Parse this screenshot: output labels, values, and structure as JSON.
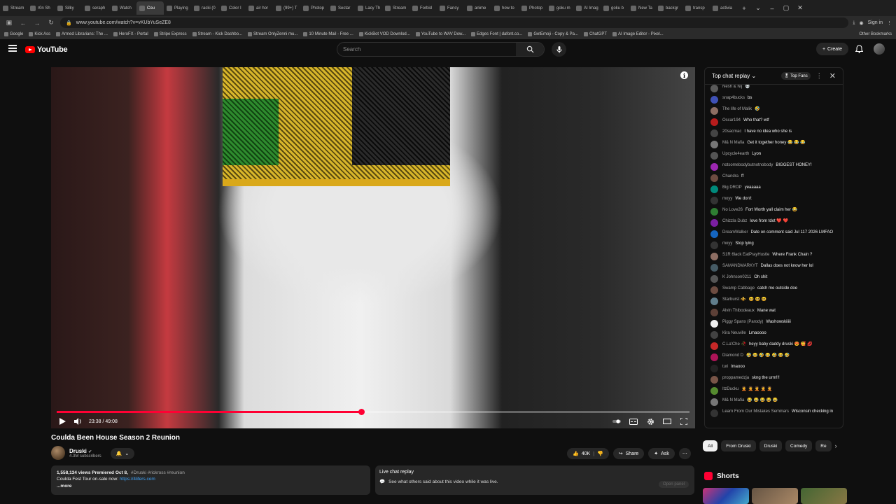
{
  "browser": {
    "tabs": [
      "Stream",
      "r0n Sh",
      "Silky",
      "seraph",
      "Watch",
      "Cou",
      "Playing",
      "racki (0",
      "Color I",
      "air hor",
      "(99+) T",
      "Photop",
      "Sectar",
      "Lacy Th",
      "Stream",
      "Forbid",
      "Fancy",
      "anime",
      "how to",
      "Photop",
      "goku m",
      "AI Imag",
      "goku b",
      "New Ta",
      "backgr",
      "transp",
      "activia"
    ],
    "active_tab_index": 5,
    "url": "www.youtube.com/watch?v=vKUbYuSeZE8",
    "sign_in": "Sign in",
    "bookmarks": [
      "Google",
      "Kick Ass",
      "Armed Librarians: The ...",
      "HeroFX - Portal",
      "Stripe Express",
      "Stream - Kick Dashbo...",
      "Stream OnlyZenni mu...",
      "10 Minute Mail - Free ...",
      "KickBot VOD Downlod...",
      "YouTube to WAV Dow...",
      "Edges Font | dafont.co...",
      "GetEmoji - Copy & Pa...",
      "ChatGPT",
      "AI Image Editor - Pixel..."
    ],
    "other_bookmarks": "Other Bookmarks"
  },
  "header": {
    "logo": "YouTube",
    "search_placeholder": "Search",
    "create_label": "Create"
  },
  "player": {
    "time": "23:38 / 49:08",
    "progress": 0.481
  },
  "chat": {
    "title": "Top chat replay",
    "top_fans": "Top Fans",
    "messages": [
      {
        "author": "Nesh & Nij",
        "text": "💀",
        "avatar_color": "#5a5a5a"
      },
      {
        "author": "snap4bucks",
        "text": "bs",
        "avatar_color": "#3f51b5"
      },
      {
        "author": "The life of Malik",
        "text": "🤣",
        "avatar_color": "#8d6e63"
      },
      {
        "author": "Oscar194",
        "text": "Who that? wtf",
        "avatar_color": "#b71c1c"
      },
      {
        "author": "20sacmac",
        "text": "I have no idea who she is",
        "avatar_color": "#444"
      },
      {
        "author": "M& N Mafia",
        "text": "Get it together honey 😂 😂 😂",
        "avatar_color": "#777"
      },
      {
        "author": "Upcycle4earth",
        "text": "Lyon",
        "avatar_color": "#555"
      },
      {
        "author": "notsomebodybutnotnobody",
        "text": "BIGGEST HONEY!",
        "avatar_color": "#9c27b0"
      },
      {
        "author": "Chandra",
        "text": "ff",
        "avatar_color": "#6d4c41"
      },
      {
        "author": "Big DROP",
        "text": "yeaaaaa",
        "avatar_color": "#00897b"
      },
      {
        "author": "moyy",
        "text": "We don't",
        "avatar_color": "#333"
      },
      {
        "author": "No Love26",
        "text": "Fort Worth yall claim her 😂",
        "avatar_color": "#2e7d32"
      },
      {
        "author": "Chizzla Dubz",
        "text": "love from tdot ❤️ ❤️",
        "avatar_color": "#7b1fa2"
      },
      {
        "author": "DreamWalker",
        "text": "Date on comment said Jul 117 2026 LMFAO",
        "avatar_color": "#1565c0"
      },
      {
        "author": "moyy",
        "text": "Stop lying",
        "avatar_color": "#333"
      },
      {
        "author": "S1R 6lack EatPrayHustle",
        "text": "Where Frank Chain ?",
        "avatar_color": "#8d6e63"
      },
      {
        "author": "SAMANDMARKYT",
        "text": "Dallas does not know her lol",
        "avatar_color": "#455a64"
      },
      {
        "author": "K Johnson0211",
        "text": "Oh shit",
        "avatar_color": "#555"
      },
      {
        "author": "Swamp Cabbage",
        "text": "catch me outside doe",
        "avatar_color": "#6d4c41"
      },
      {
        "author": "Starburst ⚜️",
        "text": "😆 😆 😆",
        "avatar_color": "#607d8b"
      },
      {
        "author": "Alvin Thibodeaux",
        "text": "Mane wat",
        "avatar_color": "#5d4037"
      },
      {
        "author": "Piggy Spanx (Parody)",
        "text": "Washowskiiiii",
        "avatar_color": "#eeeeee"
      },
      {
        "author": "Kira Neuville",
        "text": "Lmaoooo",
        "avatar_color": "#424242"
      },
      {
        "author": "C.La'Che 🥀",
        "text": "heyy baby daddy druski 😍 🥰 💋",
        "avatar_color": "#c62828"
      },
      {
        "author": "Diamond D",
        "text": "🤣 😂 🤣 😂 🤣 😂 🤣",
        "avatar_color": "#ad1457"
      },
      {
        "author": "turi",
        "text": "lmaooo",
        "avatar_color": "#222"
      },
      {
        "author": "proppamedzja",
        "text": "skng the urm!!!",
        "avatar_color": "#795548"
      },
      {
        "author": "ItzDucku",
        "text": "🤦 🤦 🤦 🤦 🤦",
        "avatar_color": "#558b2f"
      },
      {
        "author": "M& N Mafia",
        "text": "😂 😂 😂 😂 😂",
        "avatar_color": "#777"
      },
      {
        "author": "Learn From Our Mistakes Seminars",
        "text": "Wisconsin checking in",
        "avatar_color": "#333"
      }
    ]
  },
  "video": {
    "title": "Coulda Been House Season 2 Reunion",
    "channel": "Druski",
    "subscribers": "4.3M subscribers",
    "likes": "40K",
    "share": "Share",
    "ask": "Ask",
    "views_line": "1,558,134 views  Premiered Oct 8,",
    "tags": "#Druski #rickross #reunion",
    "tour_text": "Coulda Fest Tour on-sale now: ",
    "tour_link": "https://4lifers.com",
    "more": "...more"
  },
  "live_replay": {
    "title": "Live chat replay",
    "subtitle": "See what others said about this video while it was live.",
    "open_panel": "Open panel"
  },
  "chips": [
    "All",
    "From Druski",
    "Druski",
    "Comedy",
    "Re"
  ],
  "shorts_label": "Shorts"
}
